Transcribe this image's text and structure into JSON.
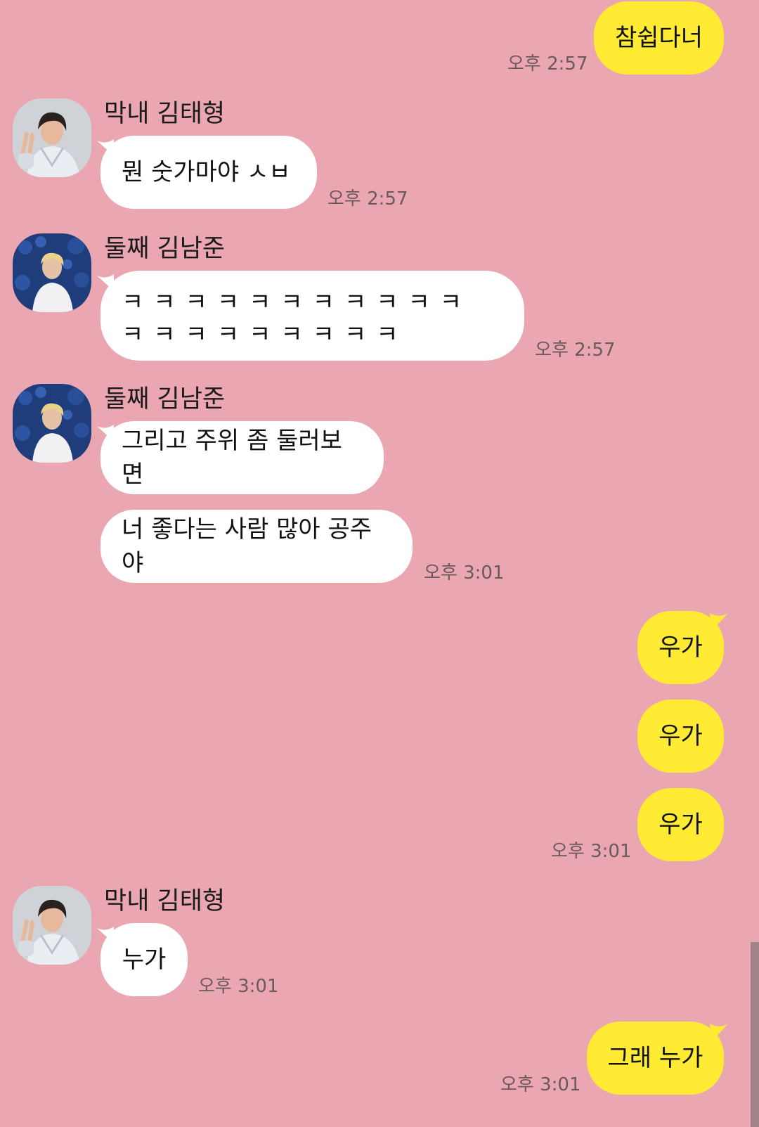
{
  "contacts": {
    "tae": {
      "name": "막내 김태형",
      "avatar_icon": "avatar-photo-icon"
    },
    "nam": {
      "name": "둘째 김남준",
      "avatar_icon": "avatar-photo-icon"
    }
  },
  "messages": [
    {
      "from": "me",
      "text": "참쉽다너",
      "time": "오후 2:57"
    },
    {
      "from": "tae",
      "name": "막내 김태형",
      "text": "뭔 숫가마야 ㅅㅂ",
      "time": "오후 2:57"
    },
    {
      "from": "nam",
      "name": "둘째 김남준",
      "text": "ㅋㅋㅋㅋㅋㅋㅋㅋㅋㅋㅋㅋㅋㅋㅋㅋㅋㅋㅋㅋ",
      "time": "오후 2:57"
    },
    {
      "from": "nam",
      "name": "둘째 김남준",
      "text": "그리고 주위 좀 둘러보면"
    },
    {
      "from": "nam",
      "text": "너 좋다는 사람 많아 공주야",
      "time": "오후 3:01"
    },
    {
      "from": "me",
      "text": "우가"
    },
    {
      "from": "me",
      "text": "우가"
    },
    {
      "from": "me",
      "text": "우가",
      "time": "오후 3:01"
    },
    {
      "from": "tae",
      "name": "막내 김태형",
      "text": "누가",
      "time": "오후 3:01"
    },
    {
      "from": "me",
      "text": "그래 누가",
      "time": "오후 3:01"
    }
  ],
  "colors": {
    "background": "#EBA7B1",
    "incoming_bubble": "#FFFFFF",
    "outgoing_bubble": "#FFEB33"
  }
}
